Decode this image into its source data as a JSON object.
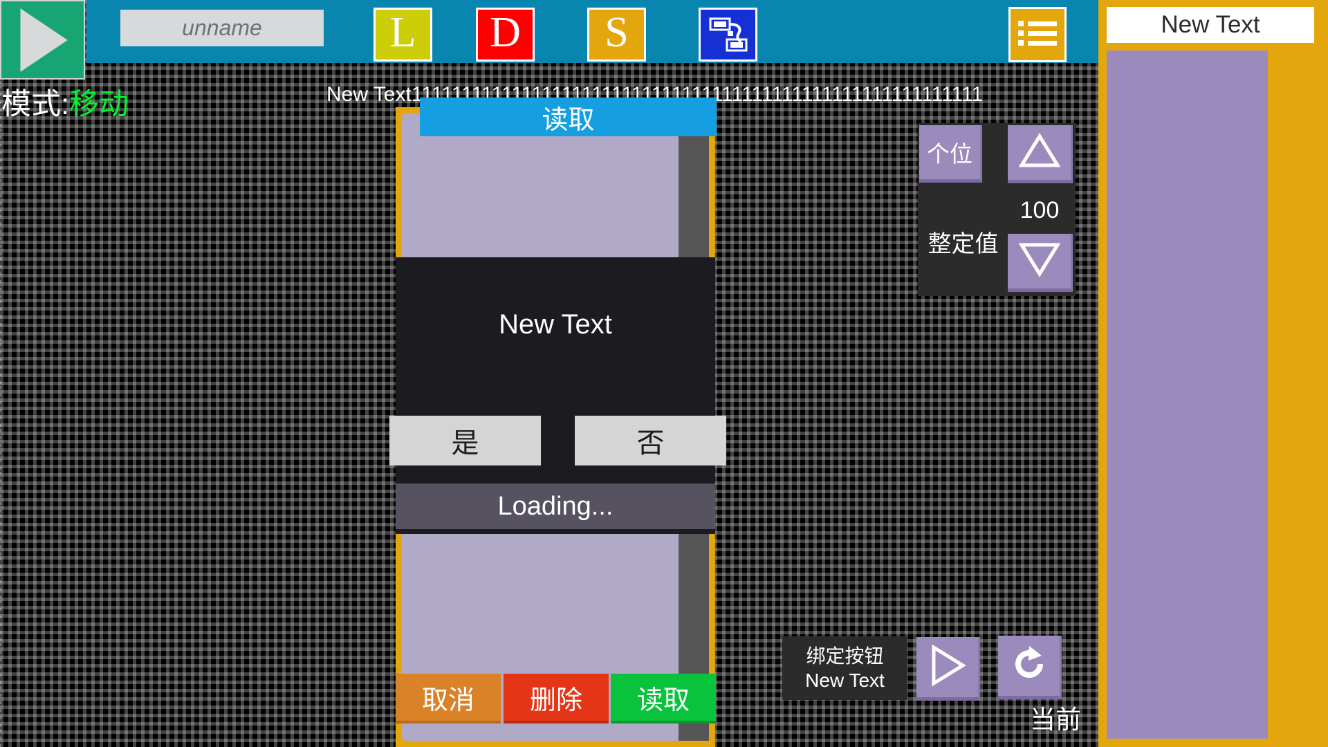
{
  "app": {
    "mode_prefix": "模式:",
    "mode_value": "移动",
    "canvas_label": "New Text111111111111111111111111111111111111111111111111111111111"
  },
  "toolbar": {
    "play_icon": "play-triangle-icon",
    "name_field_placeholder": "unname",
    "name_field_value": "",
    "buttons": [
      {
        "label": "L",
        "name": "load-button",
        "color": "#cdcd0a"
      },
      {
        "label": "D",
        "name": "delete-button",
        "color": "#fe0000"
      },
      {
        "label": "S",
        "name": "save-button",
        "color": "#e3a60c"
      },
      {
        "label": "",
        "name": "robot-arm-button",
        "color": "#1531d5"
      }
    ],
    "menu_icon": "list-menu-icon",
    "menu_color": "#e3a60c"
  },
  "dialog": {
    "title": "读取",
    "frame_color": "#e3a60c",
    "inner_color": "#b0a9c8",
    "buttons": {
      "cancel": "取消",
      "delete": "删除",
      "read": "读取"
    }
  },
  "modal": {
    "message": "New Text",
    "yes": "是",
    "no": "否",
    "loading": "Loading..."
  },
  "spinner": {
    "unit_label": "个位",
    "value_label": "整定值",
    "value": "100",
    "up_icon": "triangle-up-icon",
    "down_icon": "triangle-down-icon"
  },
  "bind": {
    "title": "绑定按钮",
    "subtitle": "New Text",
    "play_icon": "play-triangle-icon",
    "refresh_icon": "refresh-icon",
    "current_label": "当前"
  },
  "sidebar": {
    "header": "New Text",
    "panel_color": "#9b8bbd",
    "background": "#e3a60c"
  },
  "colors": {
    "toolbar_bg": "#0986b0",
    "accent_orange": "#e3a60c",
    "accent_green": "#17a673",
    "mode_green": "#00f32a",
    "title_blue": "#169fe0",
    "purple": "#9b8bbd"
  }
}
